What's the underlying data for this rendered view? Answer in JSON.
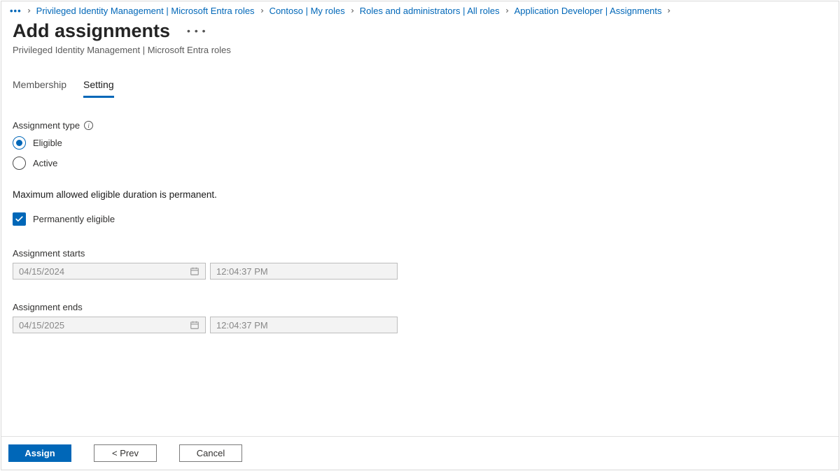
{
  "breadcrumb": {
    "items": [
      "Privileged Identity Management | Microsoft Entra roles",
      "Contoso | My roles",
      "Roles and administrators | All roles",
      "Application Developer | Assignments"
    ]
  },
  "header": {
    "title": "Add assignments",
    "subtitle": "Privileged Identity Management | Microsoft Entra roles"
  },
  "tabs": {
    "membership": "Membership",
    "setting": "Setting"
  },
  "form": {
    "assignment_type_label": "Assignment type",
    "radio_eligible": "Eligible",
    "radio_active": "Active",
    "selected_radio": "eligible",
    "duration_note": "Maximum allowed eligible duration is permanent.",
    "checkbox_label": "Permanently eligible",
    "checkbox_checked": true,
    "starts_label": "Assignment starts",
    "ends_label": "Assignment ends",
    "start_date": "04/15/2024",
    "start_time": "12:04:37 PM",
    "end_date": "04/15/2025",
    "end_time": "12:04:37 PM"
  },
  "footer": {
    "assign": "Assign",
    "prev": "<  Prev",
    "cancel": "Cancel"
  }
}
